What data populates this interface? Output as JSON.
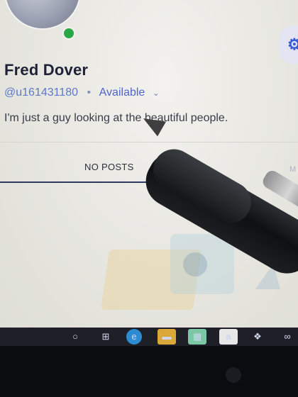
{
  "profile": {
    "name": "Fred Dover",
    "handle": "@u161431180",
    "separator": "•",
    "status": "Available",
    "status_chevron": "⌄",
    "bio": "I'm just a guy looking at the beautiful people."
  },
  "tabs": {
    "active_label": "NO POSTS",
    "partial_label": "M"
  },
  "settings": {
    "icon": "gear-icon",
    "glyph": "⚙"
  },
  "taskbar": {
    "items": [
      {
        "name": "search-icon",
        "glyph": "○"
      },
      {
        "name": "task-view-icon",
        "glyph": "⊞"
      },
      {
        "name": "edge-icon",
        "glyph": "e"
      },
      {
        "name": "file-explorer-icon",
        "glyph": "▬"
      },
      {
        "name": "calendar-icon",
        "glyph": "▦"
      },
      {
        "name": "amazon-icon",
        "glyph": "a"
      },
      {
        "name": "dropbox-icon",
        "glyph": "❖"
      },
      {
        "name": "infinity-icon",
        "glyph": "∞"
      }
    ]
  },
  "colors": {
    "status_dot": "#28a745",
    "handle": "#5f78c9",
    "name": "#1d2236",
    "underline": "#2f3a63"
  }
}
